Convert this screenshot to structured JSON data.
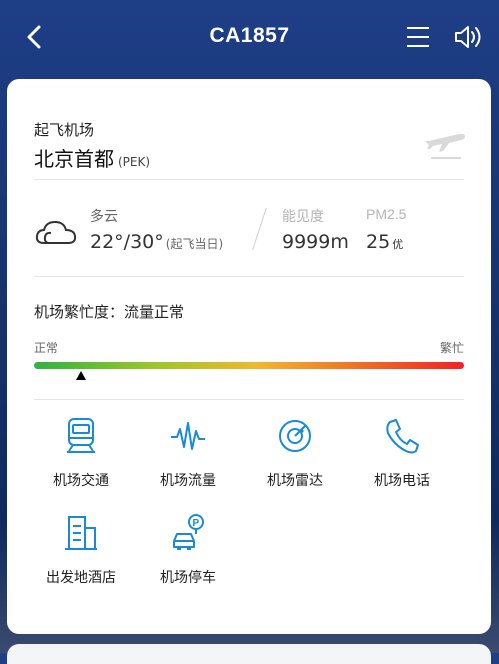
{
  "header": {
    "title": "CA1857",
    "back_icon": "chevron-left-icon",
    "menu_icon": "menu-icon",
    "sound_icon": "speaker-icon"
  },
  "departure": {
    "label": "起飞机场",
    "city": "北京首都",
    "code": "(PEK)",
    "icon": "plane-departure-icon"
  },
  "weather": {
    "condition": "多云",
    "temperature": "22°/30°",
    "temperature_note": "(起飞当日)",
    "visibility_label": "能见度",
    "visibility_value": "9999m",
    "pm_label": "PM2.5",
    "pm_value": "25",
    "pm_grade": "优"
  },
  "busyness": {
    "title": "机场繁忙度：流量正常",
    "scale_min_label": "正常",
    "scale_max_label": "繁忙",
    "level": 0.11
  },
  "services": [
    {
      "label": "机场交通",
      "icon": "train-icon"
    },
    {
      "label": "机场流量",
      "icon": "waveform-icon"
    },
    {
      "label": "机场雷达",
      "icon": "radar-icon"
    },
    {
      "label": "机场电话",
      "icon": "phone-icon"
    },
    {
      "label": "出发地酒店",
      "icon": "hotel-building-icon"
    },
    {
      "label": "机场停车",
      "icon": "parking-car-icon"
    }
  ],
  "colors": {
    "accent": "#1a8ad6",
    "header_bg": "#1e3e86",
    "bar_start": "#2fb33f",
    "bar_end": "#ee2424"
  }
}
